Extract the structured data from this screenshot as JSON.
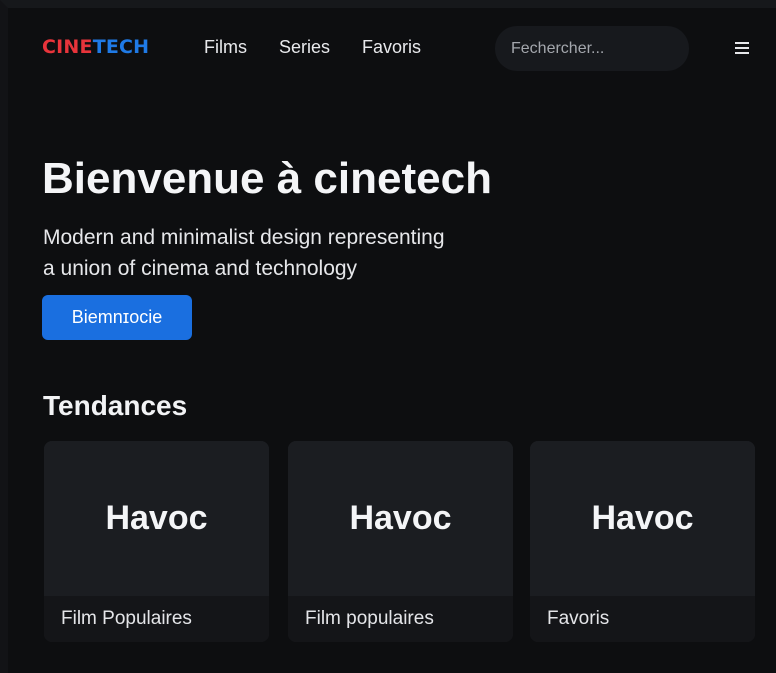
{
  "header": {
    "logo_cine": "CINE",
    "logo_tech": "TECH",
    "nav": [
      {
        "label": "Films"
      },
      {
        "label": "Series"
      },
      {
        "label": "Favoris"
      }
    ],
    "search_placeholder": "Fechercher...",
    "menu_icon": "hamburger-menu-icon"
  },
  "hero": {
    "title": "Bienvenue à cinetech",
    "subtitle_line1": "Modern and minimalist design representing",
    "subtitle_line2": "a union of cinema and technology",
    "button_label": "Biemnɪocie"
  },
  "trending": {
    "title": "Tendances",
    "cards": [
      {
        "title": "Havoc",
        "caption": "Film Populaires"
      },
      {
        "title": "Havoc",
        "caption": "Film populaires"
      },
      {
        "title": "Havoc",
        "caption": "Favoris"
      }
    ]
  },
  "colors": {
    "background": "#0d0e10",
    "logo_red": "#e8343b",
    "logo_blue": "#1f7ae6",
    "button_blue": "#1a6fe0",
    "card_bg": "#1b1d21"
  }
}
